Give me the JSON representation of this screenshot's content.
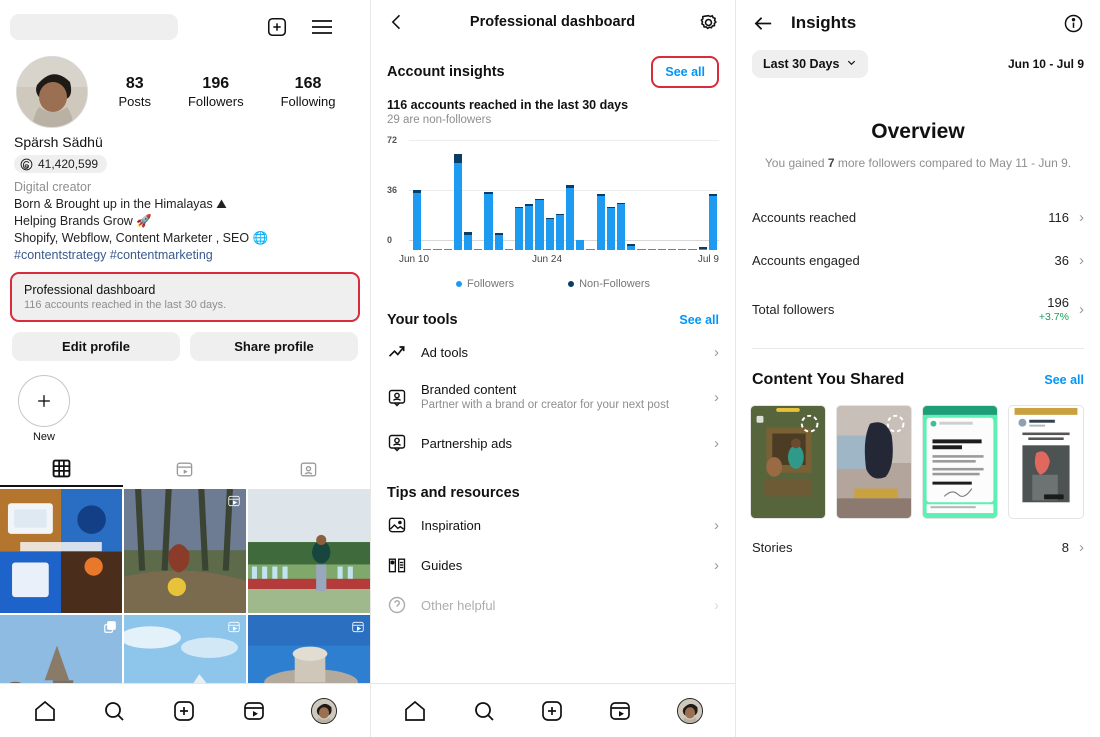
{
  "profile": {
    "search_placeholder": "",
    "icons": {
      "create": "plus-square-icon",
      "menu": "hamburger-menu-icon"
    },
    "stats": [
      {
        "num": "83",
        "label": "Posts"
      },
      {
        "num": "196",
        "label": "Followers"
      },
      {
        "num": "168",
        "label": "Following"
      }
    ],
    "name": "Spärsh Sädhü",
    "threads_count": "41,420,599",
    "category": "Digital creator",
    "bio_lines": [
      "Born & Brought up in the Himalayas ⛰",
      "Helping Brands Grow 🚀",
      "Shopify, Webflow, Content Marketer , SEO 🌐"
    ],
    "bio_hashtags": "#contentstrategy #contentmarketing",
    "pro_card": {
      "title": "Professional dashboard",
      "subtitle": "116 accounts reached in the last 30 days."
    },
    "buttons": {
      "edit": "Edit profile",
      "share": "Share profile"
    },
    "new_highlight": {
      "label": "New"
    },
    "tabs": [
      {
        "name": "grid",
        "icon": "grid-icon",
        "active": true
      },
      {
        "name": "reels",
        "icon": "reels-icon",
        "active": false
      },
      {
        "name": "tagged",
        "icon": "tagged-person-icon",
        "active": false
      }
    ],
    "grid_cells": [
      {
        "alt": "collage-cake-and-balloons",
        "badge": "none",
        "c1": "#d8cfc2",
        "c2": "#2f63b5"
      },
      {
        "alt": "forest-trail-reel",
        "badge": "reels",
        "c1": "#5b6a4c",
        "c2": "#2e3a2a"
      },
      {
        "alt": "person-at-stadium",
        "badge": "none",
        "c1": "#cfd9df",
        "c2": "#6f8a6a"
      },
      {
        "alt": "temple-with-blue-sky",
        "badge": "carousel",
        "c1": "#7fa8d6",
        "c2": "#8d7f72"
      },
      {
        "alt": "snow-mountain-reel",
        "badge": "reels",
        "c1": "#8dc2ea",
        "c2": "#49607a"
      },
      {
        "alt": "monument-blue-sky-reel",
        "badge": "reels",
        "c1": "#2f7fd0",
        "c2": "#9a9287"
      }
    ],
    "bottom_nav": [
      "home-icon",
      "search-icon",
      "create-icon",
      "reels-icon",
      "profile-avatar"
    ]
  },
  "dashboard": {
    "back_icon": "chevron-left-icon",
    "title": "Professional dashboard",
    "settings_icon": "gear-icon",
    "account_insights": {
      "title": "Account insights",
      "see_all": "See all",
      "see_all_highlighted": true,
      "headline": "116 accounts reached in the last 30 days",
      "subline": "29 are non-followers"
    },
    "your_tools": {
      "title": "Your tools",
      "see_all": "See all",
      "items": [
        {
          "icon": "trending-up-arrow-icon",
          "title": "Ad tools",
          "subtitle": ""
        },
        {
          "icon": "branded-content-icon",
          "title": "Branded content",
          "subtitle": "Partner with a brand or creator for your next post"
        },
        {
          "icon": "partnership-ads-icon",
          "title": "Partnership ads",
          "subtitle": ""
        }
      ]
    },
    "tips_and_resources": {
      "title": "Tips and resources",
      "items": [
        {
          "icon": "image-inspiration-icon",
          "title": "Inspiration",
          "subtitle": ""
        },
        {
          "icon": "guides-book-icon",
          "title": "Guides",
          "subtitle": ""
        },
        {
          "icon": "help-circle-icon",
          "title": "Other helpful",
          "subtitle": ""
        }
      ]
    },
    "bottom_nav": [
      "home-icon",
      "search-icon",
      "create-icon",
      "reels-icon",
      "profile-avatar"
    ]
  },
  "insights": {
    "back_icon": "arrow-left-icon",
    "title": "Insights",
    "info_icon": "info-circle-icon",
    "period_chip": "Last 30 Days",
    "chevron": "chevron-down-icon",
    "date_range": "Jun 10 - Jul 9",
    "overview_title": "Overview",
    "overview_sub_pre": "You gained ",
    "overview_sub_value": "7",
    "overview_sub_post": " more followers compared to May 11 - Jun 9.",
    "rows": [
      {
        "label": "Accounts reached",
        "value": "116",
        "delta": ""
      },
      {
        "label": "Accounts engaged",
        "value": "36",
        "delta": ""
      },
      {
        "label": "Total followers",
        "value": "196",
        "delta": "+3.7%"
      }
    ],
    "content_shared": {
      "title": "Content You Shared",
      "see_all": "See all",
      "thumbs": [
        {
          "alt": "story-illustrated-dinner-scene",
          "c1": "#5d6b3f",
          "c2": "#3d4630"
        },
        {
          "alt": "story-person-indoor-clip",
          "c1": "#a89a94",
          "c2": "#6d6a70"
        },
        {
          "alt": "post-green-quote-card",
          "c1": "#5ff0b5",
          "c2": "#f4f4f4"
        },
        {
          "alt": "post-white-profile-card",
          "c1": "#ffffff",
          "c2": "#9aa3a6"
        }
      ]
    },
    "stories_row": {
      "label": "Stories",
      "value": "8"
    }
  },
  "chart_data": {
    "type": "bar",
    "title": "116 accounts reached in the last 30 days",
    "subtitle": "29 are non-followers",
    "stacked": true,
    "xlabel": "",
    "ylabel": "",
    "ylim": [
      0,
      72
    ],
    "yticks": [
      0,
      36,
      72
    ],
    "grid": true,
    "legend_position": "bottom",
    "x_tick_labels": [
      "Jun 10",
      "Jun 24",
      "Jul 9"
    ],
    "x_tick_indices": [
      0,
      14,
      29
    ],
    "categories": [
      "Jun 10",
      "Jun 11",
      "Jun 12",
      "Jun 13",
      "Jun 14",
      "Jun 15",
      "Jun 16",
      "Jun 17",
      "Jun 18",
      "Jun 19",
      "Jun 20",
      "Jun 21",
      "Jun 22",
      "Jun 23",
      "Jun 24",
      "Jun 25",
      "Jun 26",
      "Jun 27",
      "Jun 28",
      "Jun 29",
      "Jun 30",
      "Jul 1",
      "Jul 2",
      "Jul 3",
      "Jul 4",
      "Jul 5",
      "Jul 6",
      "Jul 7",
      "Jul 8",
      "Jul 9"
    ],
    "series": [
      {
        "name": "Followers",
        "color": "#1d9bf0",
        "values": [
          41,
          1,
          1,
          1,
          63,
          11,
          1,
          40,
          11,
          1,
          30,
          32,
          36,
          22,
          25,
          45,
          7,
          1,
          39,
          30,
          33,
          3,
          1,
          1,
          1,
          1,
          1,
          1,
          1,
          39
        ]
      },
      {
        "name": "Non-Followers",
        "color": "#0b3d66",
        "values": [
          2,
          0,
          0,
          0,
          6,
          2,
          0,
          2,
          1,
          0,
          1,
          1,
          1,
          1,
          1,
          2,
          0,
          0,
          1,
          1,
          1,
          1,
          0,
          0,
          0,
          0,
          0,
          0,
          1,
          1
        ]
      }
    ]
  }
}
